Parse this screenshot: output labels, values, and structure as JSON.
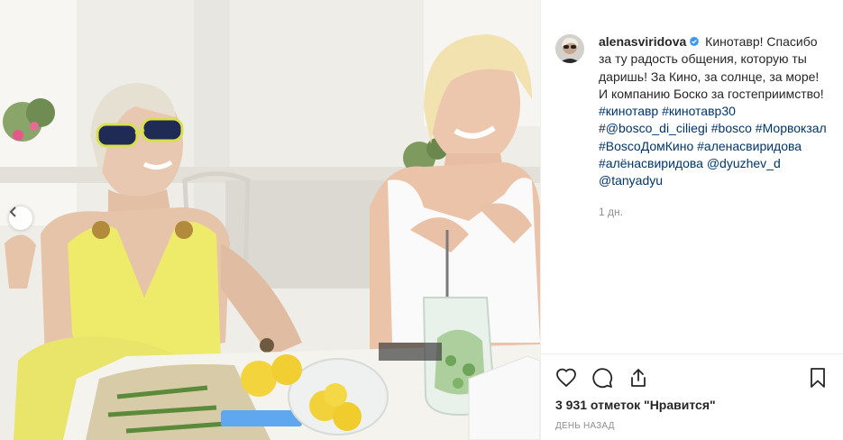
{
  "post": {
    "username": "alenasviridova",
    "verified": true,
    "caption_segments": [
      {
        "type": "text",
        "value": "Кинотавр! Спасибо за ту радость общения, которую ты даришь! За Кино, за солнце, за море! И компанию Боско за гостеприимство! "
      },
      {
        "type": "tag",
        "value": "#кинотавр"
      },
      {
        "type": "text",
        "value": " "
      },
      {
        "type": "tag",
        "value": "#кинотавр30"
      },
      {
        "type": "text",
        "value": " #"
      },
      {
        "type": "tag",
        "value": "@bosco_di_ciliegi"
      },
      {
        "type": "text",
        "value": " "
      },
      {
        "type": "tag",
        "value": "#bosco"
      },
      {
        "type": "text",
        "value": " "
      },
      {
        "type": "tag",
        "value": "#Морвокзал"
      },
      {
        "type": "text",
        "value": " "
      },
      {
        "type": "tag",
        "value": "#BoscoДомКино"
      },
      {
        "type": "text",
        "value": " "
      },
      {
        "type": "tag",
        "value": "#аленасвиридова"
      },
      {
        "type": "text",
        "value": " "
      },
      {
        "type": "tag",
        "value": "#алёнасвиридова"
      },
      {
        "type": "text",
        "value": " "
      },
      {
        "type": "tag",
        "value": "@dyuzhev_d"
      },
      {
        "type": "text",
        "value": " "
      },
      {
        "type": "tag",
        "value": "@tanyadyu"
      }
    ],
    "time_ago": "1 дн.",
    "likes_text": "3 931 отметок \"Нравится\"",
    "date_text": "День назад"
  },
  "icons": {
    "like": "heart-icon",
    "comment": "comment-bubble-icon",
    "share": "share-icon",
    "save": "bookmark-icon",
    "carousel_prev": "chevron-left-icon",
    "verified": "verified-badge-icon"
  },
  "colors": {
    "text": "#262626",
    "hashtag": "#003569",
    "muted": "#8e8e8e",
    "verified": "#3897f0",
    "divider": "#efefef"
  }
}
